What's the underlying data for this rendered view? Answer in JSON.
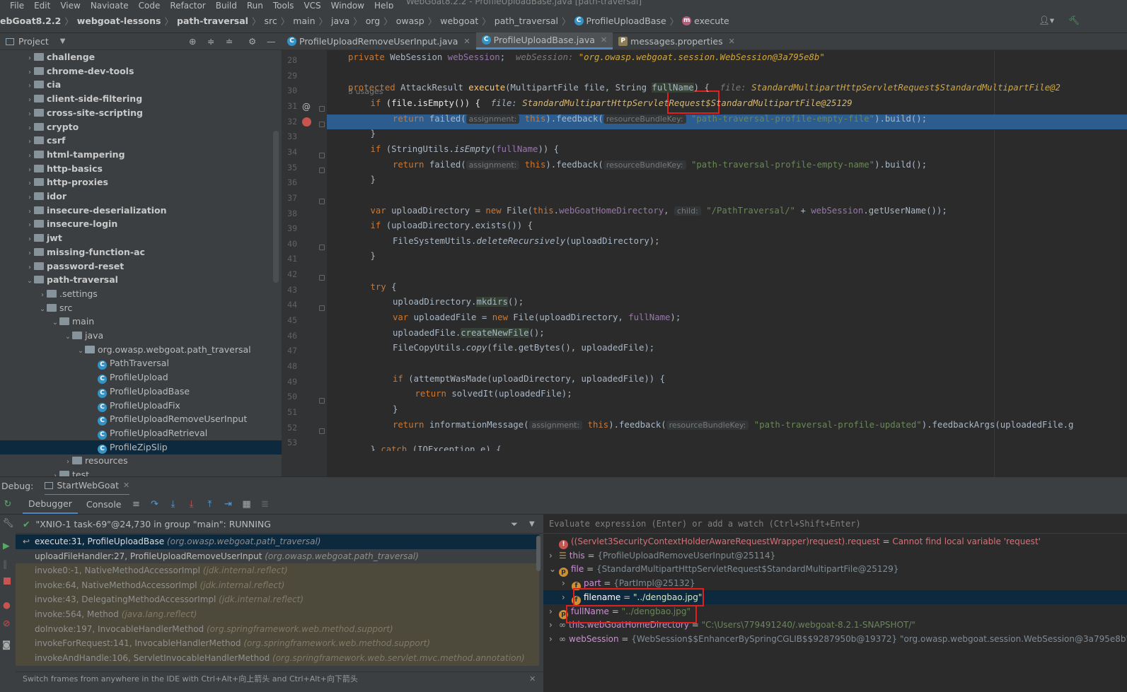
{
  "menu": {
    "items": [
      "File",
      "Edit",
      "View",
      "Navigate",
      "Code",
      "Refactor",
      "Build",
      "Run",
      "Tools",
      "VCS",
      "Window",
      "Help"
    ],
    "window_title": "WebGoat8.2.2 - ProfileUploadBase.java [path-traversal]"
  },
  "breadcrumb": [
    "ebGoat8.2.2",
    "webgoat-lessons",
    "path-traversal",
    "src",
    "main",
    "java",
    "org",
    "owasp",
    "webgoat",
    "path_traversal",
    "ProfileUploadBase",
    "execute"
  ],
  "project_panel": {
    "title": "Project"
  },
  "tree": [
    {
      "label": "challenge",
      "depth": 0,
      "bold": true,
      "arrow": "›"
    },
    {
      "label": "chrome-dev-tools",
      "depth": 0,
      "bold": true,
      "arrow": "›"
    },
    {
      "label": "cia",
      "depth": 0,
      "bold": true,
      "arrow": "›"
    },
    {
      "label": "client-side-filtering",
      "depth": 0,
      "bold": true,
      "arrow": "›"
    },
    {
      "label": "cross-site-scripting",
      "depth": 0,
      "bold": true,
      "arrow": "›"
    },
    {
      "label": "crypto",
      "depth": 0,
      "bold": true,
      "arrow": "›"
    },
    {
      "label": "csrf",
      "depth": 0,
      "bold": true,
      "arrow": "›"
    },
    {
      "label": "html-tampering",
      "depth": 0,
      "bold": true,
      "arrow": "›"
    },
    {
      "label": "http-basics",
      "depth": 0,
      "bold": true,
      "arrow": "›"
    },
    {
      "label": "http-proxies",
      "depth": 0,
      "bold": true,
      "arrow": "›"
    },
    {
      "label": "idor",
      "depth": 0,
      "bold": true,
      "arrow": "›"
    },
    {
      "label": "insecure-deserialization",
      "depth": 0,
      "bold": true,
      "arrow": "›"
    },
    {
      "label": "insecure-login",
      "depth": 0,
      "bold": true,
      "arrow": "›"
    },
    {
      "label": "jwt",
      "depth": 0,
      "bold": true,
      "arrow": "›"
    },
    {
      "label": "missing-function-ac",
      "depth": 0,
      "bold": true,
      "arrow": "›"
    },
    {
      "label": "password-reset",
      "depth": 0,
      "bold": true,
      "arrow": "›"
    },
    {
      "label": "path-traversal",
      "depth": 0,
      "bold": true,
      "arrow": "⌄"
    },
    {
      "label": ".settings",
      "depth": 1,
      "bold": false,
      "arrow": "›"
    },
    {
      "label": "src",
      "depth": 1,
      "bold": false,
      "arrow": "⌄"
    },
    {
      "label": "main",
      "depth": 2,
      "bold": false,
      "arrow": "⌄"
    },
    {
      "label": "java",
      "depth": 3,
      "bold": false,
      "arrow": "⌄"
    },
    {
      "label": "org.owasp.webgoat.path_traversal",
      "depth": 4,
      "bold": false,
      "arrow": "⌄"
    },
    {
      "label": "PathTraversal",
      "depth": 5,
      "cls": true
    },
    {
      "label": "ProfileUpload",
      "depth": 5,
      "cls": true
    },
    {
      "label": "ProfileUploadBase",
      "depth": 5,
      "cls": true
    },
    {
      "label": "ProfileUploadFix",
      "depth": 5,
      "cls": true
    },
    {
      "label": "ProfileUploadRemoveUserInput",
      "depth": 5,
      "cls": true
    },
    {
      "label": "ProfileUploadRetrieval",
      "depth": 5,
      "cls": true
    },
    {
      "label": "ProfileZipSlip",
      "depth": 5,
      "cls": true,
      "selected": true
    },
    {
      "label": "resources",
      "depth": 3,
      "bold": false,
      "arrow": "›"
    },
    {
      "label": "test",
      "depth": 2,
      "bold": false,
      "arrow": "›"
    }
  ],
  "tabs": [
    {
      "label": "ProfileUploadRemoveUserInput.java",
      "active": false,
      "icon": "C"
    },
    {
      "label": "ProfileUploadBase.java",
      "active": true,
      "icon": "C"
    },
    {
      "label": "messages.properties",
      "active": false,
      "icon": "P"
    }
  ],
  "editor": {
    "line_numbers": [
      "28",
      "29",
      "30",
      "31",
      "32",
      "33",
      "34",
      "35",
      "36",
      "37",
      "38",
      "39",
      "40",
      "41",
      "42",
      "43",
      "44",
      "45",
      "46",
      "47",
      "48",
      "49",
      "50",
      "51",
      "52",
      "53"
    ],
    "usages": "3 usages",
    "l28": {
      "kw": "private",
      "type": " WebSession ",
      "field": "webSession",
      "semi": ";",
      "inl": "webSession: ",
      "inlv": "\"org.owasp.webgoat.session.WebSession@3a795e8b\""
    },
    "l30": {
      "kw": "protected",
      "a": " AttackResult ",
      "fn": "execute",
      "b": "(MultipartFile file, String ",
      "hl": "fullName",
      "c": ") {",
      "inl": "file: ",
      "inlv": "StandardMultipartHttpServletRequest$StandardMultipartFile@2"
    },
    "l31": {
      "kw": "if",
      "a": " (file.isEmpty()) {",
      "inl": "file: ",
      "inlv": "StandardMultipartHttpServletRequest$StandardMultipartFile@25129"
    },
    "l32": {
      "kw": "return",
      "a": " failed(",
      "hint": "assignment:",
      "kw2": "this",
      "b": ").feedback(",
      "hint2": "resourceBundleKey:",
      "str": "\"path-traversal-profile-empty-file\"",
      "c": ").build();"
    },
    "l33": "}",
    "l34": {
      "kw": "if",
      "a": " (StringUtils.",
      "it": "isEmpty",
      "b": "(",
      "fld": "fullName",
      "c": ")) {"
    },
    "l35": {
      "kw": "return",
      "a": " failed(",
      "hint": "assignment:",
      "kw2": "this",
      "b": ").feedback(",
      "hint2": "resourceBundleKey:",
      "str": "\"path-traversal-profile-empty-name\"",
      "c": ").build();"
    },
    "l36": "}",
    "l38": {
      "kw": "var",
      "a": " uploadDirectory = ",
      "kw2": "new",
      "b": " File(",
      "kw3": "this",
      "c": ".",
      "fld": "webGoatHomeDirectory",
      "d": ", ",
      "hint": "child:",
      "str": "\"/PathTraversal/\"",
      "e": " + ",
      "fld2": "webSession",
      "f": ".getUserName());"
    },
    "l39": {
      "kw": "if",
      "a": " (uploadDirectory.exists()) {"
    },
    "l40": {
      "a": "FileSystemUtils.",
      "it": "deleteRecursively",
      "b": "(uploadDirectory);"
    },
    "l41": "}",
    "l43": {
      "kw": "try",
      "a": " {"
    },
    "l44": {
      "a": "uploadDirectory.",
      "hl": "mkdirs",
      "b": "();"
    },
    "l45": {
      "kw": "var",
      "a": " uploadedFile = ",
      "kw2": "new",
      "b": " File(uploadDirectory, ",
      "fld": "fullName",
      "c": ");"
    },
    "l46": {
      "a": "uploadedFile.",
      "hl": "createNewFile",
      "b": "();"
    },
    "l47": {
      "a": "FileCopyUtils.",
      "it": "copy",
      "b": "(file.getBytes(), uploadedFile);"
    },
    "l49": {
      "kw": "if",
      "a": " (attemptWasMade(uploadDirectory, uploadedFile)) {"
    },
    "l50": {
      "kw": "return",
      "a": " solvedIt(uploadedFile);"
    },
    "l51": "}",
    "l52": {
      "kw": "return",
      "a": " informationMessage(",
      "hint": "assignment:",
      "kw2": "this",
      "b": ").feedback(",
      "hint2": "resourceBundleKey:",
      "str": "\"path-traversal-profile-updated\"",
      "c": ").feedbackArgs(uploadedFile.g"
    },
    "l54": {
      "a": "} ",
      "kw": "catch",
      "b": " (IOException e) {"
    }
  },
  "debug": {
    "label": "Debug:",
    "config": "StartWebGoat",
    "tab_debugger": "Debugger",
    "tab_console": "Console",
    "thread": "\"XNIO-1 task-69\"@24,730 in group \"main\": RUNNING",
    "eval_placeholder": "Evaluate expression (Enter) or add a watch (Ctrl+Shift+Enter)",
    "frames": [
      {
        "m": "execute:31, ProfileUploadBase ",
        "p": "(org.owasp.webgoat.path_traversal)",
        "type": "current"
      },
      {
        "m": "uploadFileHandler:27, ProfileUploadRemoveUserInput ",
        "p": "(org.owasp.webgoat.path_traversal)",
        "type": "user"
      },
      {
        "m": "invoke0:-1, NativeMethodAccessorImpl ",
        "p": "(jdk.internal.reflect)",
        "type": "lib"
      },
      {
        "m": "invoke:64, NativeMethodAccessorImpl ",
        "p": "(jdk.internal.reflect)",
        "type": "lib"
      },
      {
        "m": "invoke:43, DelegatingMethodAccessorImpl ",
        "p": "(jdk.internal.reflect)",
        "type": "lib"
      },
      {
        "m": "invoke:564, Method ",
        "p": "(java.lang.reflect)",
        "type": "lib"
      },
      {
        "m": "doInvoke:197, InvocableHandlerMethod ",
        "p": "(org.springframework.web.method.support)",
        "type": "lib"
      },
      {
        "m": "invokeForRequest:141, InvocableHandlerMethod ",
        "p": "(org.springframework.web.method.support)",
        "type": "lib"
      },
      {
        "m": "invokeAndHandle:106, ServletInvocableHandlerMethod ",
        "p": "(org.springframework.web.servlet.mvc.method.annotation)",
        "type": "lib"
      }
    ],
    "status": "Switch frames from anywhere in the IDE with Ctrl+Alt+向上箭头 and Ctrl+Alt+向下箭头",
    "vars": [
      {
        "indent": 0,
        "icon": "err",
        "name": "((Servlet3SecurityContextHolderAwareRequestWrapper)request).request",
        "eq": " = ",
        "val": "Cannot find local variable 'request'",
        "vcls": "err"
      },
      {
        "indent": 0,
        "icon": "list",
        "arrow": "›",
        "name": "this",
        "eq": " = ",
        "val": "{ProfileUploadRemoveUserInput@25114}",
        "vcls": "ref"
      },
      {
        "indent": 0,
        "icon": "p",
        "arrow": "⌄",
        "name": "file",
        "eq": " = ",
        "val": "{StandardMultipartHttpServletRequest$StandardMultipartFile@25129}",
        "vcls": "ref"
      },
      {
        "indent": 1,
        "icon": "f",
        "arrow": "›",
        "name": "part",
        "eq": " = ",
        "val": "{PartImpl@25132}",
        "vcls": "ref"
      },
      {
        "indent": 1,
        "icon": "f",
        "arrow": "›",
        "name": "filename",
        "eq": " = ",
        "val": "\"../dengbao.jpg\"",
        "vcls": "str",
        "selected": true
      },
      {
        "indent": 0,
        "icon": "p",
        "arrow": "›",
        "name": "fullName",
        "eq": " = ",
        "val": "\"../dengbao.jpg\"",
        "vcls": "str"
      },
      {
        "indent": 0,
        "icon": "oo",
        "arrow": "›",
        "name": "this.webGoatHomeDirectory",
        "eq": " = ",
        "val": "\"C:\\Users\\779491240/.webgoat-8.2.1-SNAPSHOT/\"",
        "vcls": "str"
      },
      {
        "indent": 0,
        "icon": "oo",
        "arrow": "›",
        "name": "webSession",
        "eq": " = ",
        "val": "{WebSession$$EnhancerBySpringCGLIB$$9287950b@19372} \"org.owasp.webgoat.session.WebSession@3a795e8b\"",
        "vcls": "ref"
      }
    ]
  },
  "colors": {
    "accent": "#4a88c7",
    "exec_line": "#2d5c8e",
    "highlight_box": "#e0201d",
    "breakpoint": "#c75450"
  }
}
